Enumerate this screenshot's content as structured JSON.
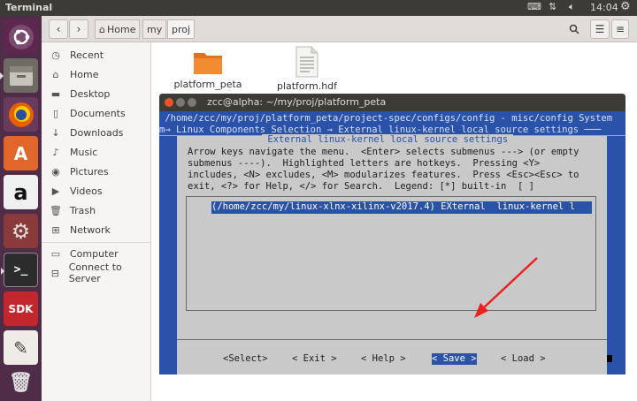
{
  "topbar": {
    "app_title": "Terminal",
    "time": "14:04"
  },
  "launcher": {
    "items": [
      "ubuntu-logo",
      "files",
      "firefox",
      "software-center",
      "amazon",
      "system-settings",
      "terminal",
      "sdk",
      "text-editor",
      "trash"
    ],
    "sdk_label": "SDK"
  },
  "nav": {
    "back": "‹",
    "forward": "›",
    "home_label": "Home",
    "crumb1": "my",
    "crumb2": "proj"
  },
  "sidebar": {
    "items": [
      {
        "icon": "clock-icon",
        "label": "Recent"
      },
      {
        "icon": "home-icon",
        "label": "Home"
      },
      {
        "icon": "folder-icon",
        "label": "Desktop"
      },
      {
        "icon": "document-icon",
        "label": "Documents"
      },
      {
        "icon": "download-icon",
        "label": "Downloads"
      },
      {
        "icon": "music-icon",
        "label": "Music"
      },
      {
        "icon": "camera-icon",
        "label": "Pictures"
      },
      {
        "icon": "video-icon",
        "label": "Videos"
      },
      {
        "icon": "trash-icon",
        "label": "Trash"
      },
      {
        "icon": "network-icon",
        "label": "Network"
      },
      {
        "icon": "drive-icon",
        "label": "Computer"
      },
      {
        "icon": "server-icon",
        "label": "Connect to Server"
      }
    ]
  },
  "files": [
    {
      "name": "platform_peta",
      "kind": "folder"
    },
    {
      "name": "platform.hdf",
      "kind": "document"
    }
  ],
  "terminal": {
    "title": "zcc@alpha: ~/my/proj/platform_peta",
    "path_line": " /home/zcc/my/proj/platform_peta/project-spec/configs/config - misc/config System",
    "crumb_line": "m→ Linux Components Selection → External linux-kernel local source settings ───",
    "dialog_title": " External linux-kernel local source settings ",
    "help_lines": [
      "Arrow keys navigate the menu.  <Enter> selects submenus ---> (or empty",
      "submenus ----).  Highlighted letters are hotkeys.  Pressing <Y>",
      "includes, <N> excludes, <M> modularizes features.  Press <Esc><Esc> to",
      "exit, <?> for Help, </> for Search.  Legend: [*] built-in  [ ]"
    ],
    "selected_option": "(/home/zcc/my/linux-xlnx-xilinx-v2017.4) EXternal  linux-kernel l",
    "buttons": {
      "select": "<Select>",
      "exit": "< Exit >",
      "help": "< Help >",
      "save": "< Save >",
      "load": "< Load >"
    }
  },
  "colors": {
    "menuconfig_blue": "#2a52a8",
    "dialog_grey": "#c9c9c9",
    "launcher_bg": "#4f2d48",
    "ubuntu_orange": "#e95420",
    "arrow_red": "#e8231f"
  }
}
